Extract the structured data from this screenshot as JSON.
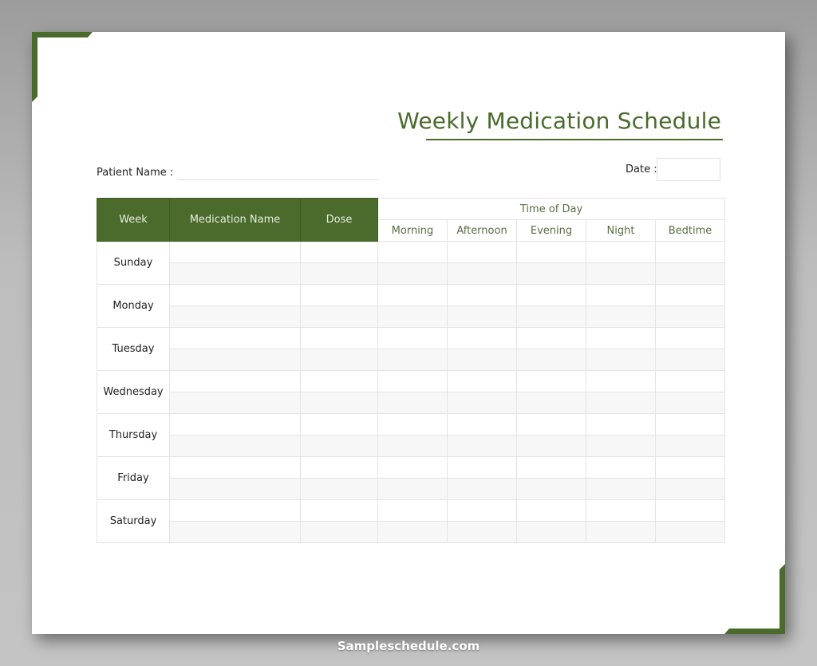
{
  "document": {
    "title": "Weekly Medication Schedule",
    "patient_name_label": "Patient Name :",
    "patient_name_value": "",
    "date_label": "Date :",
    "date_value": ""
  },
  "table": {
    "headers": {
      "week": "Week",
      "medication_name": "Medication Name",
      "dose": "Dose",
      "time_of_day": "Time of Day",
      "times": [
        "Morning",
        "Afternoon",
        "Evening",
        "Night",
        "Bedtime"
      ]
    },
    "days": [
      "Sunday",
      "Monday",
      "Tuesday",
      "Wednesday",
      "Thursday",
      "Friday",
      "Saturday"
    ],
    "rows_per_day": 2
  },
  "colors": {
    "accent": "#4a6b2b",
    "header_text": "#e8eddf",
    "subheader_text": "#5a6e45",
    "alt_row": "#f7f7f7"
  },
  "watermark": "Sampleschedule.com"
}
